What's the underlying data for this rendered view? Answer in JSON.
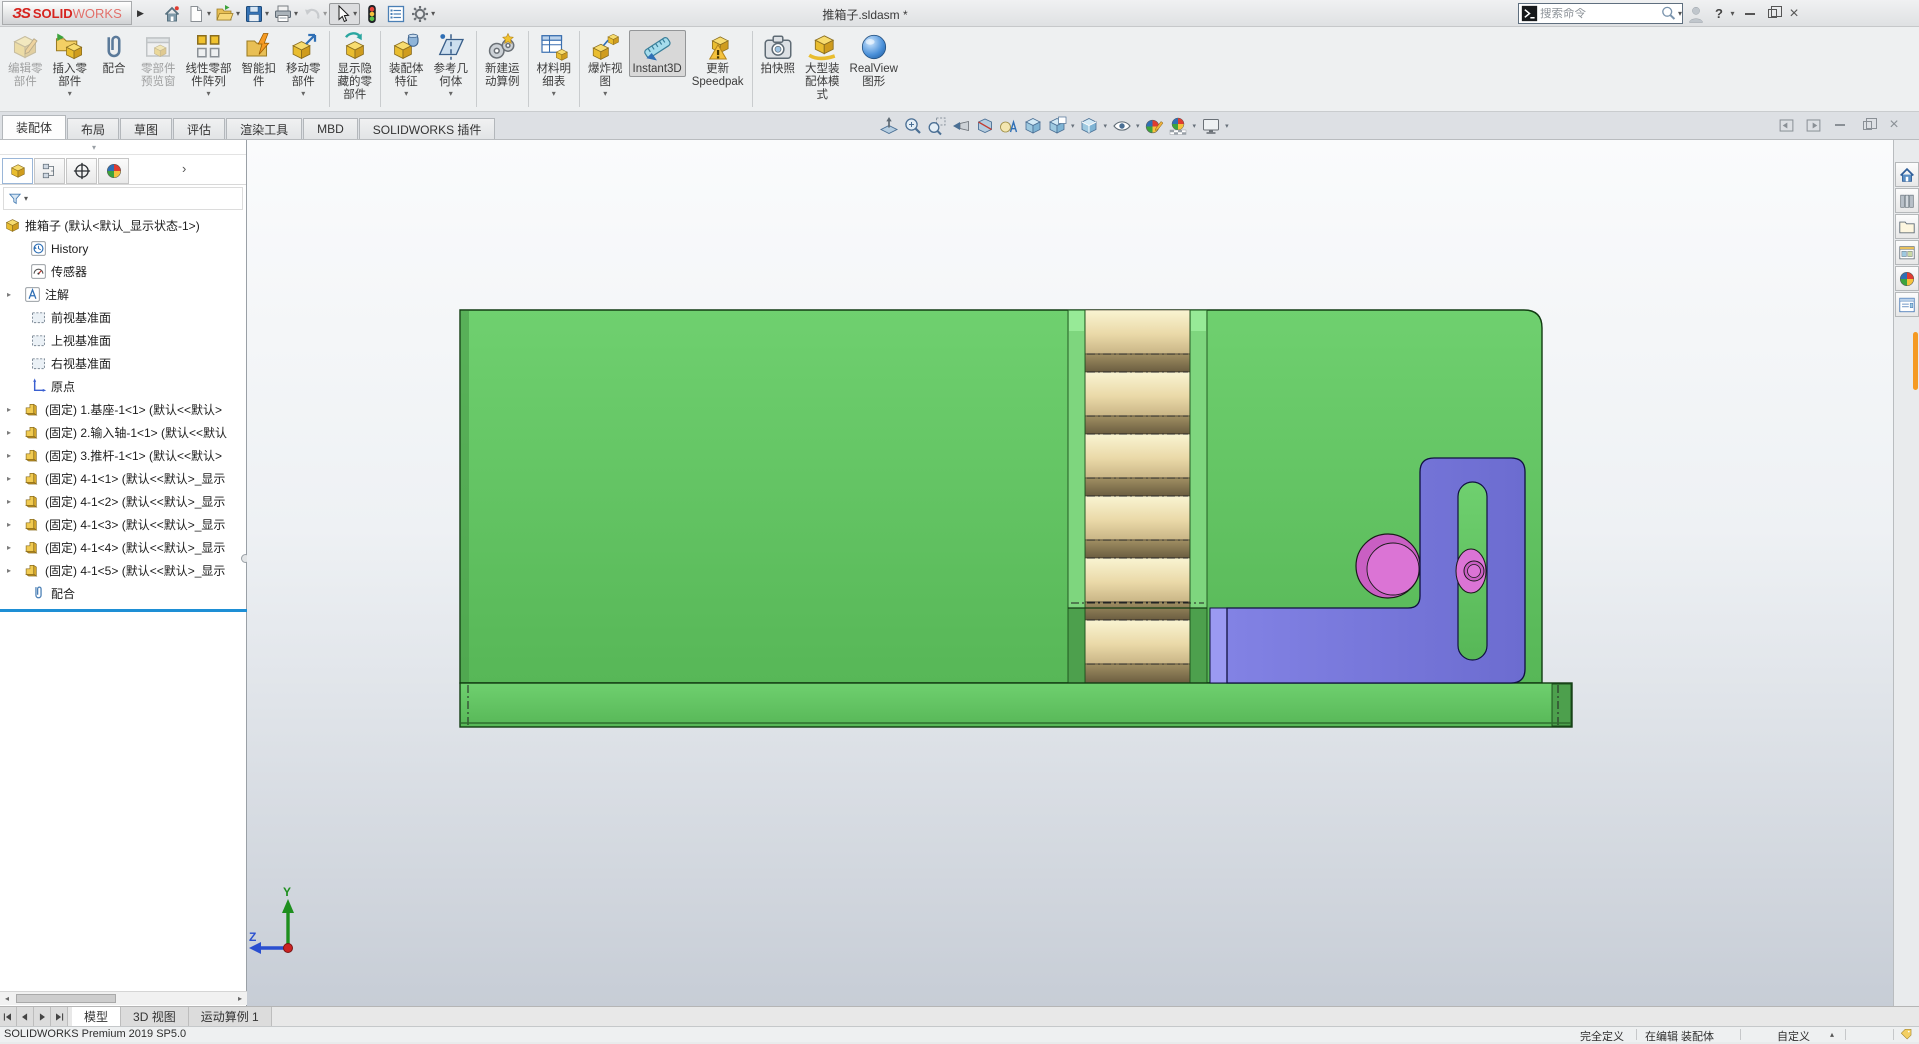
{
  "titlebar": {
    "logo": {
      "mark": "ЗS",
      "solid": "SOLID",
      "works": "WORKS"
    },
    "title": "推箱子.sldasm *",
    "search_placeholder": "搜索命令",
    "help": "?"
  },
  "ribbon": {
    "buttons": [
      {
        "name": "edit-component",
        "label": "编辑零\n部件",
        "disabled": true
      },
      {
        "name": "insert-components",
        "label": "插入零\n部件",
        "caret": true
      },
      {
        "name": "mate",
        "label": "配合"
      },
      {
        "name": "component-preview-window",
        "label": "零部件\n预览窗",
        "disabled": true
      },
      {
        "name": "linear-component-pattern",
        "label": "线性零部\n件阵列",
        "caret": true
      },
      {
        "name": "smart-fasteners",
        "label": "智能扣\n件"
      },
      {
        "name": "move-component",
        "label": "移动零\n部件",
        "caret": true
      },
      {
        "name": "show-hidden-components",
        "label": "显示隐\n藏的零\n部件"
      },
      {
        "name": "assembly-features",
        "label": "装配体\n特征",
        "caret": true
      },
      {
        "name": "reference-geometry",
        "label": "参考几\n何体",
        "caret": true
      },
      {
        "name": "new-motion-study",
        "label": "新建运\n动算例"
      },
      {
        "name": "bill-of-materials",
        "label": "材料明\n细表",
        "caret": true
      },
      {
        "name": "exploded-view",
        "label": "爆炸视\n图",
        "caret": true
      },
      {
        "name": "instant3d",
        "label": "Instant3D",
        "pressed": true
      },
      {
        "name": "update-speedpak",
        "label": "更新\nSpeedpak"
      },
      {
        "name": "take-snapshot",
        "label": "拍快照"
      },
      {
        "name": "large-assembly-mode",
        "label": "大型装\n配体模\n式"
      },
      {
        "name": "realview-graphics",
        "label": "RealView\n图形"
      }
    ]
  },
  "command_tabs": {
    "items": [
      "装配体",
      "布局",
      "草图",
      "评估",
      "渲染工具",
      "MBD",
      "SOLIDWORKS 插件"
    ],
    "active_index": 0
  },
  "feature_panel": {
    "root_label": "推箱子 (默认<默认_显示状态-1>)",
    "items": [
      {
        "label": "History",
        "icon": "history"
      },
      {
        "label": "传感器",
        "icon": "sensor"
      },
      {
        "label": "注解",
        "icon": "annotations",
        "expandable": true
      },
      {
        "label": "前视基准面",
        "icon": "plane"
      },
      {
        "label": "上视基准面",
        "icon": "plane"
      },
      {
        "label": "右视基准面",
        "icon": "plane"
      },
      {
        "label": "原点",
        "icon": "origin"
      },
      {
        "label": "(固定) 1.基座-1<1> (默认<<默认>",
        "icon": "part",
        "expandable": true
      },
      {
        "label": "(固定) 2.输入轴-1<1> (默认<<默认",
        "icon": "part",
        "expandable": true
      },
      {
        "label": "(固定) 3.推杆-1<1> (默认<<默认>",
        "icon": "part",
        "expandable": true
      },
      {
        "label": "(固定) 4-1<1> (默认<<默认>_显示",
        "icon": "part",
        "expandable": true
      },
      {
        "label": "(固定) 4-1<2> (默认<<默认>_显示",
        "icon": "part",
        "expandable": true
      },
      {
        "label": "(固定) 4-1<3> (默认<<默认>_显示",
        "icon": "part",
        "expandable": true
      },
      {
        "label": "(固定) 4-1<4> (默认<<默认>_显示",
        "icon": "part",
        "expandable": true
      },
      {
        "label": "(固定) 4-1<5> (默认<<默认>_显示",
        "icon": "part",
        "expandable": true
      },
      {
        "label": "配合",
        "icon": "mates"
      }
    ]
  },
  "viewport": {
    "triad": {
      "y": "Y",
      "z": "Z"
    }
  },
  "model": {
    "colors": {
      "green": "#5fc25f",
      "green_light": "#7ed67e",
      "green_dark": "#4da04d",
      "rack_light": "#efe5b4",
      "rack_dark": "#7d6f4c",
      "purple": "#7678da",
      "purple_light": "#9b9af2",
      "pink": "#c95fc3",
      "pink_light": "#db74d5",
      "selection_blue": "#1e8fd5",
      "taskpane_marker_orange": "#f59a23"
    }
  },
  "icons": {
    "search": "magnifier",
    "command-search": "console-prompt",
    "filter": "funnel",
    "mates": "paperclip",
    "options": "gear",
    "help": "question-mark"
  },
  "doc_tabs": {
    "tabs": [
      "模型",
      "3D 视图",
      "运动算例 1"
    ],
    "active_index": 0
  },
  "status_bar": {
    "app_version": "SOLIDWORKS Premium 2019 SP5.0",
    "define_state": "完全定义",
    "edit_state": "在编辑 装配体",
    "customize": "自定义"
  }
}
